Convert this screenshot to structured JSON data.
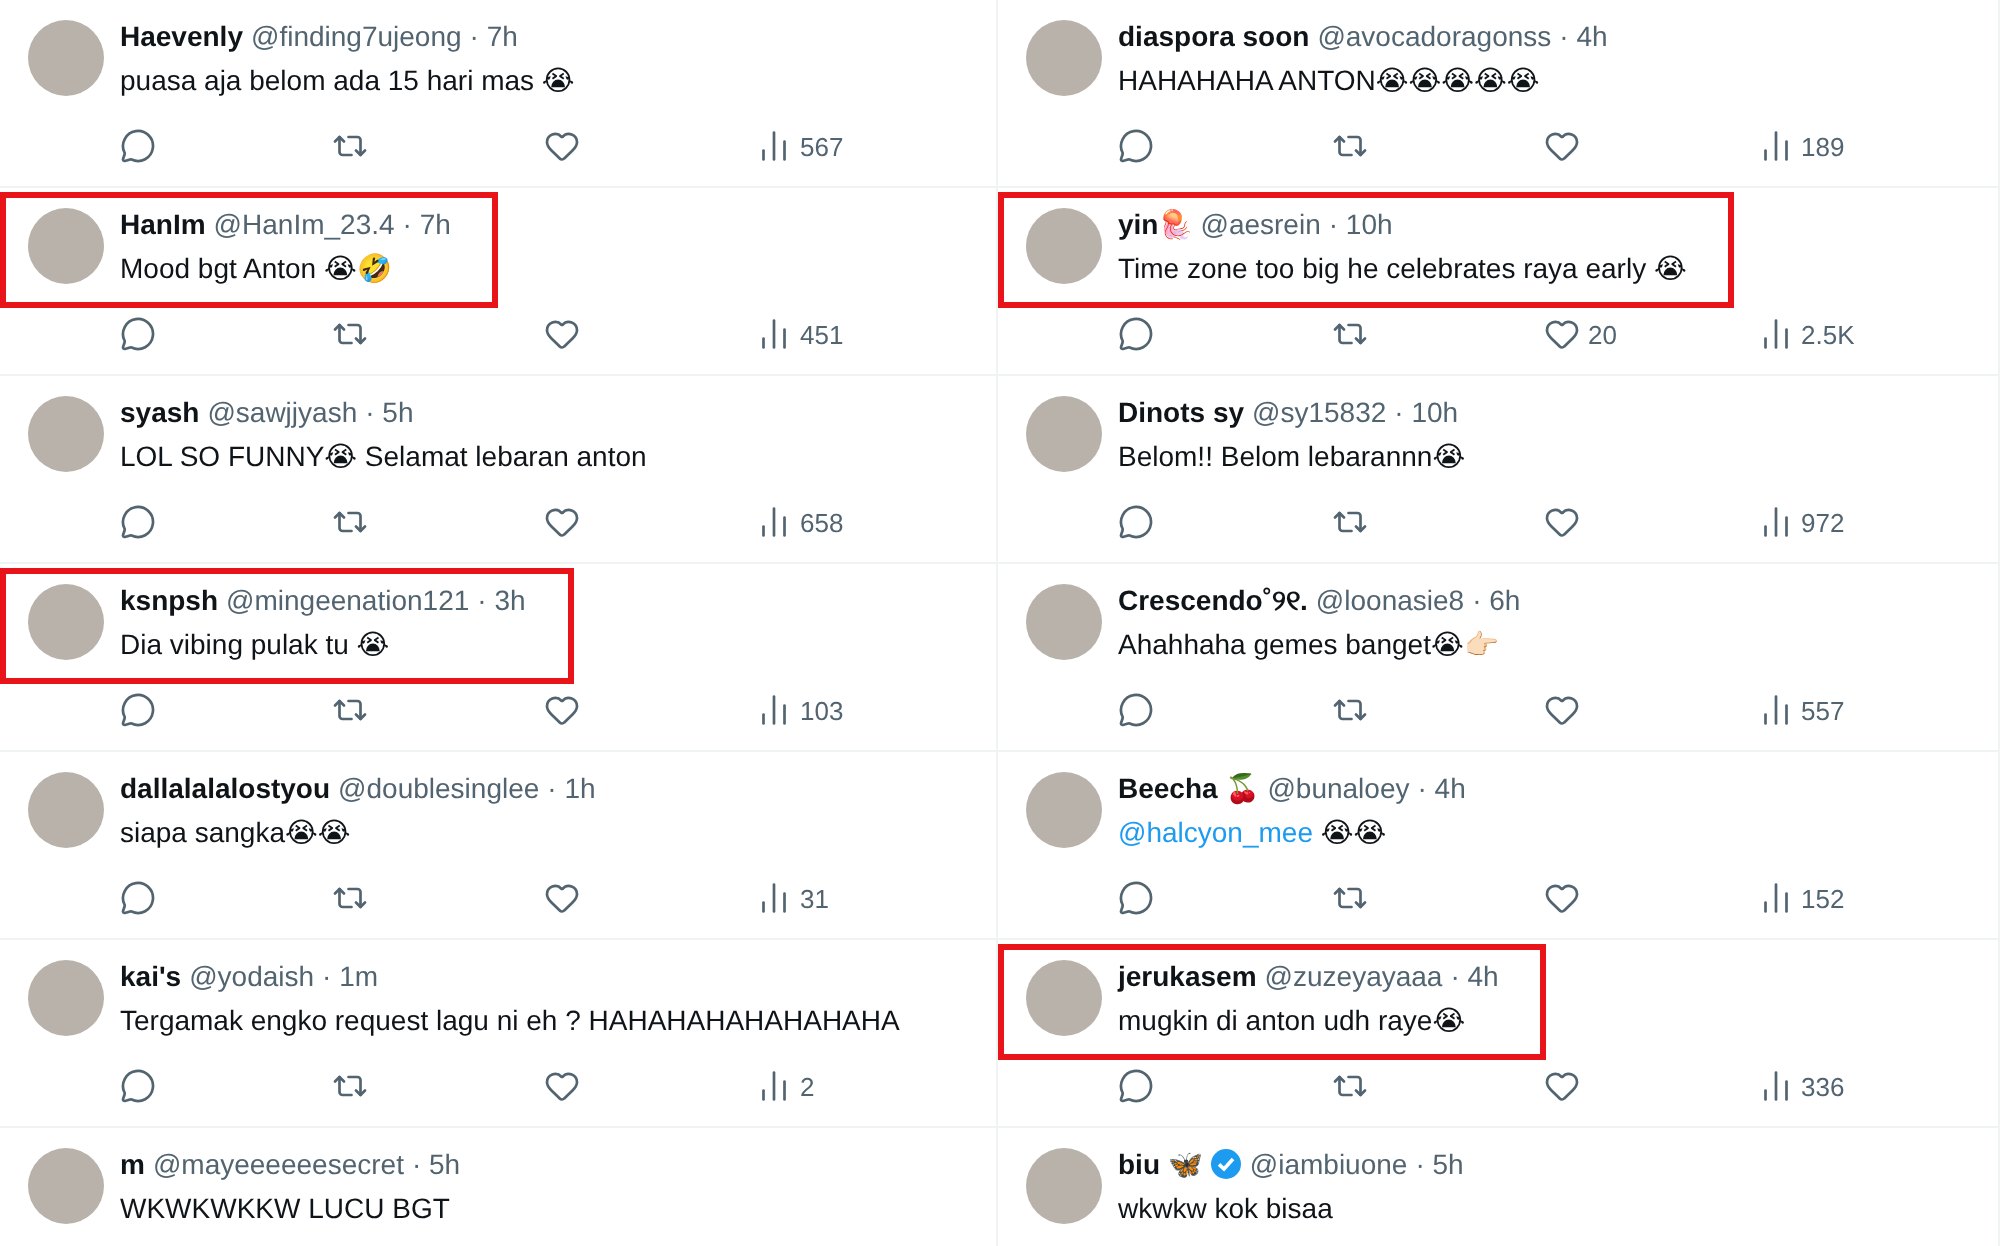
{
  "columns": [
    {
      "tweets": [
        {
          "name": "Haevenly",
          "handle": "@finding7ujeong",
          "time": "· 7h",
          "text": "puasa aja belom ada 15 hari mas 😭",
          "views": "567",
          "highlighted": false
        },
        {
          "name": "HanIm",
          "handle": "@HanIm_23.4",
          "time": "· 7h",
          "text": "Mood bgt Anton 😭🤣",
          "views": "451",
          "highlighted": true
        },
        {
          "name": "syash",
          "handle": "@sawjjyash",
          "time": "· 5h",
          "text": "LOL SO FUNNY😭 Selamat lebaran anton",
          "views": "658",
          "highlighted": false
        },
        {
          "name": "ksnpsh",
          "handle": "@mingeenation121",
          "time": "· 3h",
          "text": "Dia vibing pulak tu 😭",
          "views": "103",
          "highlighted": true
        },
        {
          "name": "dallalalalostyou",
          "handle": "@doublesinglee",
          "time": "· 1h",
          "text": "siapa sangka😭😭",
          "views": "31",
          "highlighted": false
        },
        {
          "name": "kai's",
          "handle": "@yodaish",
          "time": "· 1m",
          "text": "Tergamak engko request lagu ni eh ? HAHAHAHAHAHAHAHA",
          "views": "2",
          "highlighted": false
        },
        {
          "name": "m",
          "handle": "@mayeeeeeesecret",
          "time": "· 5h",
          "text": "WKWKWKKW LUCU BGT",
          "highlighted": false
        }
      ]
    },
    {
      "tweets": [
        {
          "name": "diaspora soon",
          "handle": "@avocadoragonss",
          "time": "· 4h",
          "text": "HAHAHAHA ANTON😭😭😭😭😭",
          "views": "189",
          "highlighted": false
        },
        {
          "name": "yin🪼",
          "handle": "@aesrein",
          "time": "· 10h",
          "text": "Time zone too big he celebrates raya early 😭",
          "likes": "20",
          "views": "2.5K",
          "highlighted": true
        },
        {
          "name": "Dinots sy",
          "handle": "@sy15832",
          "time": "· 10h",
          "text": "Belom!! Belom lebarannn😭",
          "views": "972",
          "highlighted": false
        },
        {
          "name": "Crescendo˚୨୧.",
          "handle": "@loonasie8",
          "time": "· 6h",
          "text": "Ahahhaha gemes banget😭👉🏻",
          "views": "557",
          "highlighted": false
        },
        {
          "name": "Beecha 🍒",
          "handle": "@bunaloey",
          "time": "· 4h",
          "mention": "@halcyon_mee",
          "text": " 😭😭",
          "views": "152",
          "highlighted": false
        },
        {
          "name": "jerukasem",
          "handle": "@zuzeyayaaa",
          "time": "· 4h",
          "text": "mugkin di anton udh raye😭",
          "views": "336",
          "highlighted": true
        },
        {
          "name": "biu 🦋",
          "verified": true,
          "handle": "@iambiuone",
          "time": "· 5h",
          "text": "wkwkw kok bisaa",
          "highlighted": false
        }
      ]
    }
  ]
}
